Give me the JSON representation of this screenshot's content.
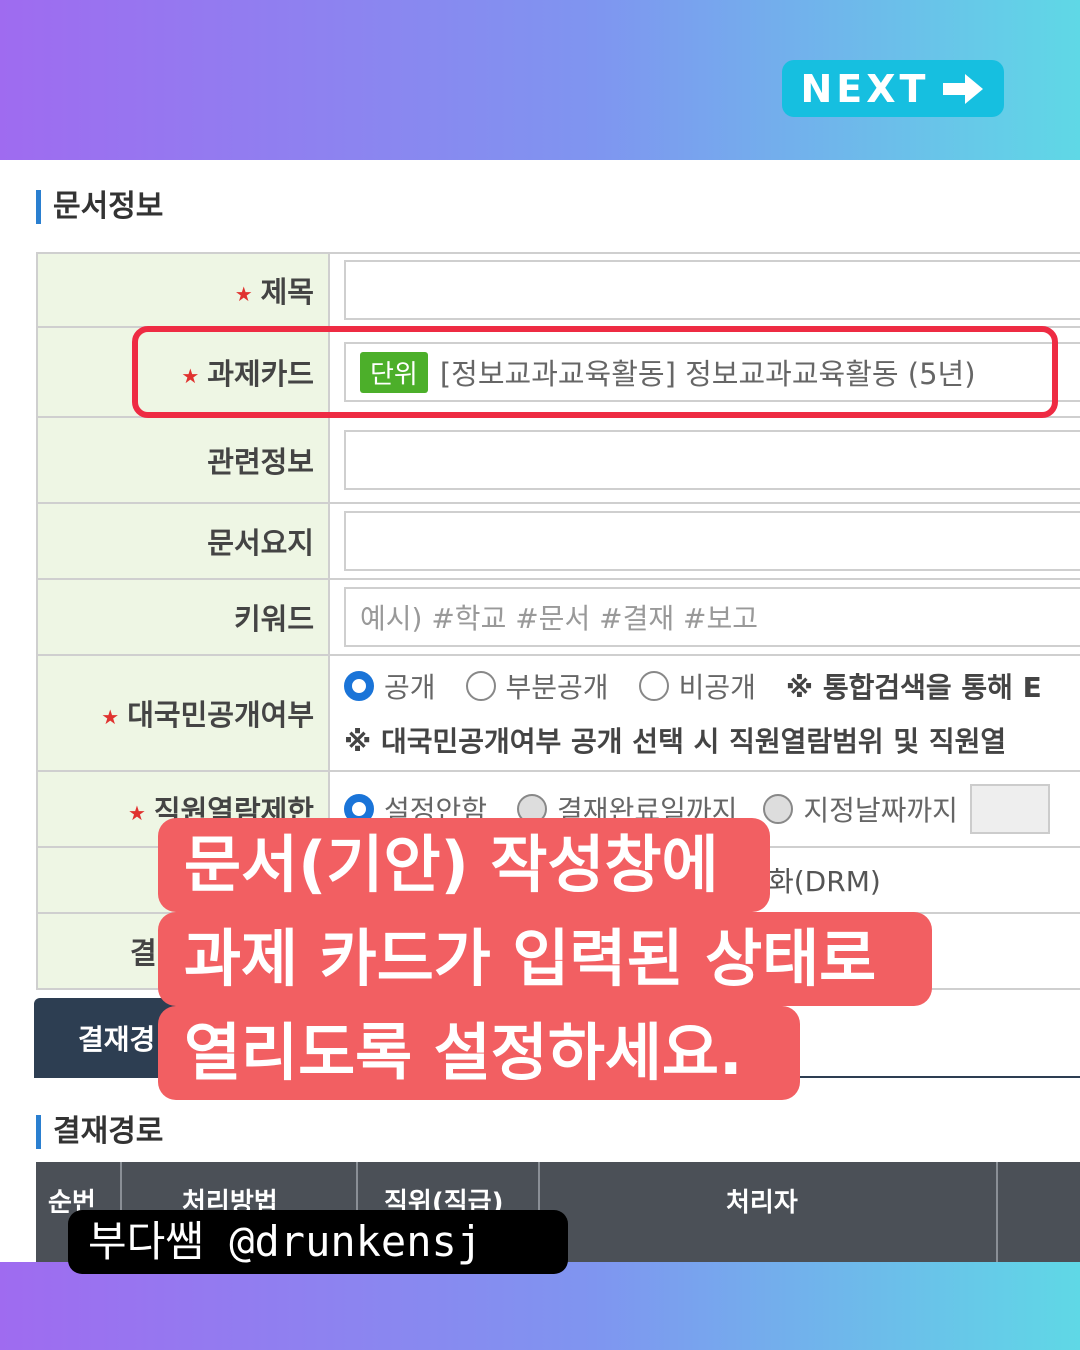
{
  "header": {
    "next_label": "NEXT",
    "next_icon": "arrow-right-icon"
  },
  "doc_info": {
    "section_title": "문서정보",
    "rows": [
      {
        "label": "제목",
        "required": true,
        "value": ""
      },
      {
        "label": "과제카드",
        "required": true,
        "badge": "단위",
        "value": "[정보교과교육활동] 정보교과교육활동 (5년)"
      },
      {
        "label": "관련정보",
        "required": false,
        "value": ""
      },
      {
        "label": "문서요지",
        "required": false,
        "value": ""
      },
      {
        "label": "키워드",
        "required": false,
        "placeholder": "예시) #학교 #문서 #결재 #보고"
      },
      {
        "label": "대국민공개여부",
        "required": true
      },
      {
        "label": "직원열람제한",
        "required": true
      }
    ],
    "public_options": [
      "공개",
      "부분공개",
      "비공개"
    ],
    "public_note1": "※ 통합검색을 통해 E",
    "public_note2": "※ 대국민공개여부 공개 선택 시 직원열람범위 및 직원열",
    "restrict_options": [
      "설정안함",
      "결재완료일까지",
      "지정날짜까지"
    ],
    "drm_text": "화(DRM)",
    "hidden_label": "결",
    "tab_label": "결재경"
  },
  "route": {
    "section_title": "결재경로",
    "columns": [
      "순번",
      "처리방법",
      "직위(직급)",
      "처리자"
    ]
  },
  "overlay": {
    "line1": "문서(기안) 작성창에",
    "line2": "과제 카드가 입력된 상태로",
    "line3": "열리도록 설정하세요."
  },
  "footer": {
    "handle": "부다쌤 @drunkensj"
  },
  "colors": {
    "accent": "#16bfe0",
    "highlight": "#ee2b43",
    "overlay": "#f25f62",
    "badge": "#4caf2a"
  }
}
